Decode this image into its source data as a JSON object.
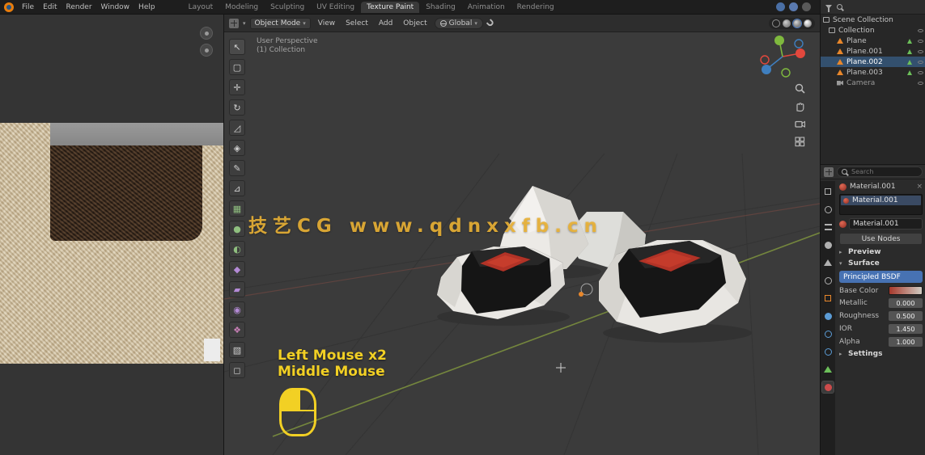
{
  "topbar": {
    "menus": [
      "File",
      "Edit",
      "Render",
      "Window",
      "Help"
    ],
    "tabs": [
      "Layout",
      "Modeling",
      "Sculpting",
      "UV Editing",
      "Texture Paint",
      "Shading",
      "Animation",
      "Rendering"
    ]
  },
  "viewport": {
    "mode": "Object Mode",
    "menus": [
      "View",
      "Select",
      "Add",
      "Object"
    ],
    "orientation": "Global",
    "info_line1": "User Perspective",
    "info_line2": "(1) Collection",
    "watermark": "技艺CG  www.qdnxxfb.cn",
    "screencast_line1": "Left Mouse x2",
    "screencast_line2": "Middle Mouse"
  },
  "outliner": {
    "rows": [
      {
        "label": "Scene Collection"
      },
      {
        "label": "Collection"
      },
      {
        "label": "Plane"
      },
      {
        "label": "Plane.001"
      },
      {
        "label": "Plane.002"
      },
      {
        "label": "Plane.003"
      },
      {
        "label": "Camera"
      }
    ]
  },
  "properties": {
    "search_placeholder": "Search",
    "breadcrumb": "Material.001",
    "slot": "Material.001",
    "name": "Material.001",
    "use_nodes": "Use Nodes",
    "preview_section": "Preview",
    "surface_section": "Surface",
    "surface_value": "Principled BSDF",
    "rows": [
      {
        "label": "Base Color",
        "value": ""
      },
      {
        "label": "Metallic",
        "value": "0.000"
      },
      {
        "label": "Roughness",
        "value": "0.500"
      },
      {
        "label": "IOR",
        "value": "1.450"
      },
      {
        "label": "Alpha",
        "value": "1.000"
      }
    ],
    "settings_section": "Settings"
  },
  "icons": {
    "chev": "▾",
    "arrow_right": "▸",
    "arrow_down": "▾",
    "close": "×",
    "tools": [
      "↖",
      "▢",
      "✛",
      "↻",
      "◿",
      "◈",
      "✎",
      "⊿",
      "▦",
      "●",
      "◐",
      "◆",
      "▰",
      "◉",
      "❖",
      "▧",
      "◻"
    ]
  },
  "colors": {
    "accent": "#4772b3",
    "screencast_yellow": "#f2d024",
    "watermark_gold": "#ebb235",
    "mesh_orange": "#e8872b",
    "data_green": "#6cbf5a",
    "axis_x_red": "#e2483d",
    "axis_y_green": "#7fb93e",
    "axis_z_blue": "#3f7fbf"
  }
}
